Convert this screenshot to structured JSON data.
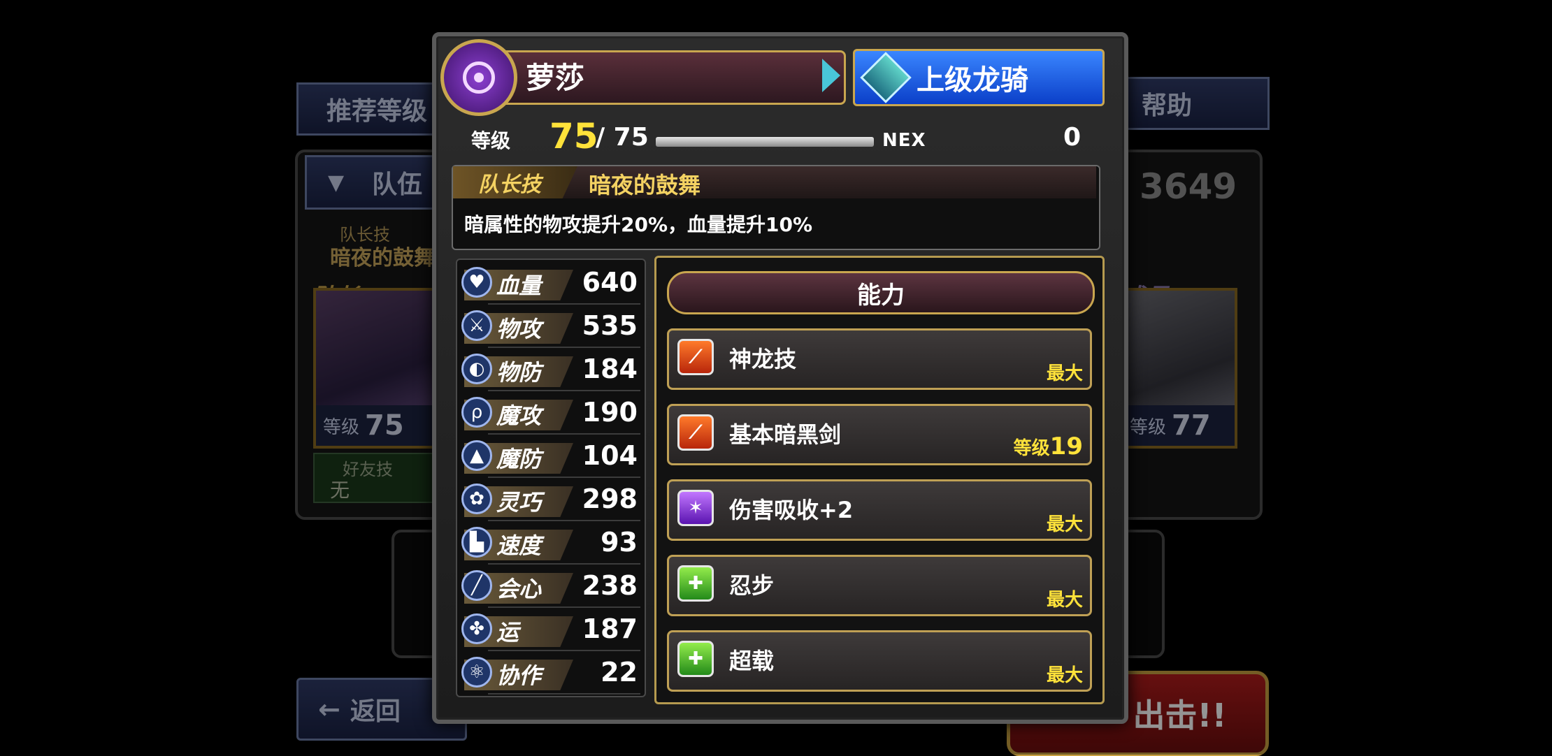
{
  "background": {
    "recommended_level_label": "推荐等级",
    "help_label": "帮助",
    "team_label": "队伍",
    "team_power": "3649",
    "leader_skill_label": "队长技",
    "leader_skill_name": "暗夜的鼓舞",
    "leader_label": "队长",
    "member_label": "成员",
    "level_prefix": "等级",
    "leader_level": "75",
    "member_level": "77",
    "friend_skill_label": "好友技",
    "friend_skill_value": "无",
    "back_label": "返回",
    "sortie_label": "出击!!"
  },
  "character": {
    "name": "萝莎",
    "class_name": "上级龙骑",
    "level_label": "等级",
    "level_current": "75",
    "level_max": "/ 75",
    "exp_fraction": 1.0,
    "nex_label": "NEX",
    "nex_value": "0",
    "element_color": "#8c3fd0"
  },
  "leader_skill": {
    "tag": "队长技",
    "name": "暗夜的鼓舞",
    "description": "暗属性的物攻提升20%，血量提升10%"
  },
  "stats": [
    {
      "icon": "heart-icon",
      "name": "血量",
      "value": "640"
    },
    {
      "icon": "sword-icon",
      "name": "物攻",
      "value": "535"
    },
    {
      "icon": "shield-icon",
      "name": "物防",
      "value": "184"
    },
    {
      "icon": "staff-icon",
      "name": "魔攻",
      "value": "190"
    },
    {
      "icon": "magic-shield-icon",
      "name": "魔防",
      "value": "104"
    },
    {
      "icon": "spiral-icon",
      "name": "灵巧",
      "value": "298"
    },
    {
      "icon": "boot-icon",
      "name": "速度",
      "value": "93"
    },
    {
      "icon": "blade-icon",
      "name": "会心",
      "value": "238"
    },
    {
      "icon": "clover-icon",
      "name": "运",
      "value": "187"
    },
    {
      "icon": "atom-icon",
      "name": "协作",
      "value": "22"
    }
  ],
  "abilities": {
    "title": "能力",
    "items": [
      {
        "name": "神龙技",
        "icon": "fire-slash-icon",
        "level_label": "最大",
        "level_prefix": "",
        "level_num": ""
      },
      {
        "name": "基本暗黑剑",
        "icon": "fire-slash-icon",
        "level_label": "",
        "level_prefix": "等级",
        "level_num": "19"
      },
      {
        "name": "伤害吸收+2",
        "icon": "absorb-icon",
        "level_label": "最大",
        "level_prefix": "",
        "level_num": ""
      },
      {
        "name": "忍步",
        "icon": "green-buff-icon",
        "level_label": "最大",
        "level_prefix": "",
        "level_num": ""
      },
      {
        "name": "超载",
        "icon": "green-buff-icon",
        "level_label": "最大",
        "level_prefix": "",
        "level_num": ""
      }
    ]
  }
}
